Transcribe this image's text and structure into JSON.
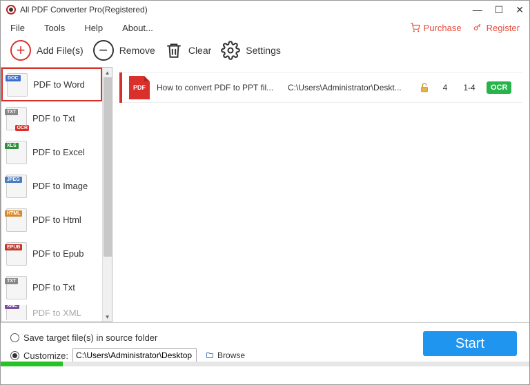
{
  "window": {
    "title": "All PDF Converter Pro(Registered)"
  },
  "menu": {
    "file": "File",
    "tools": "Tools",
    "help": "Help",
    "about": "About...",
    "purchase": "Purchase",
    "register": "Register"
  },
  "toolbar": {
    "add": "Add File(s)",
    "remove": "Remove",
    "clear": "Clear",
    "settings": "Settings"
  },
  "sidebar": {
    "items": [
      {
        "label": "PDF to Word",
        "tag": "DOC",
        "tag_color": "#3b6fcf",
        "ocr": false
      },
      {
        "label": "PDF to Txt",
        "tag": "TXT",
        "tag_color": "#888",
        "ocr": true
      },
      {
        "label": "PDF to Excel",
        "tag": "XLS",
        "tag_color": "#2f8f3f",
        "ocr": false
      },
      {
        "label": "PDF to Image",
        "tag": "JPEG",
        "tag_color": "#4a7dc0",
        "ocr": false
      },
      {
        "label": "PDF to Html",
        "tag": "HTML",
        "tag_color": "#d88a2a",
        "ocr": false
      },
      {
        "label": "PDF to Epub",
        "tag": "EPUB",
        "tag_color": "#c0392b",
        "ocr": false
      },
      {
        "label": "PDF to Txt",
        "tag": "TXT",
        "tag_color": "#888",
        "ocr": false
      },
      {
        "label": "PDF to XML",
        "tag": "XML",
        "tag_color": "#7a4fa0",
        "ocr": false
      }
    ]
  },
  "file": {
    "icon_label": "PDF",
    "name": "How to convert PDF to PPT fil...",
    "path": "C:\\Users\\Administrator\\Deskt...",
    "pages": "4",
    "range": "1-4",
    "ocr": "OCR"
  },
  "bottom": {
    "save_source": "Save target file(s) in source folder",
    "customize": "Customize:",
    "path": "C:\\Users\\Administrator\\Desktop",
    "browse": "Browse",
    "start": "Start"
  }
}
